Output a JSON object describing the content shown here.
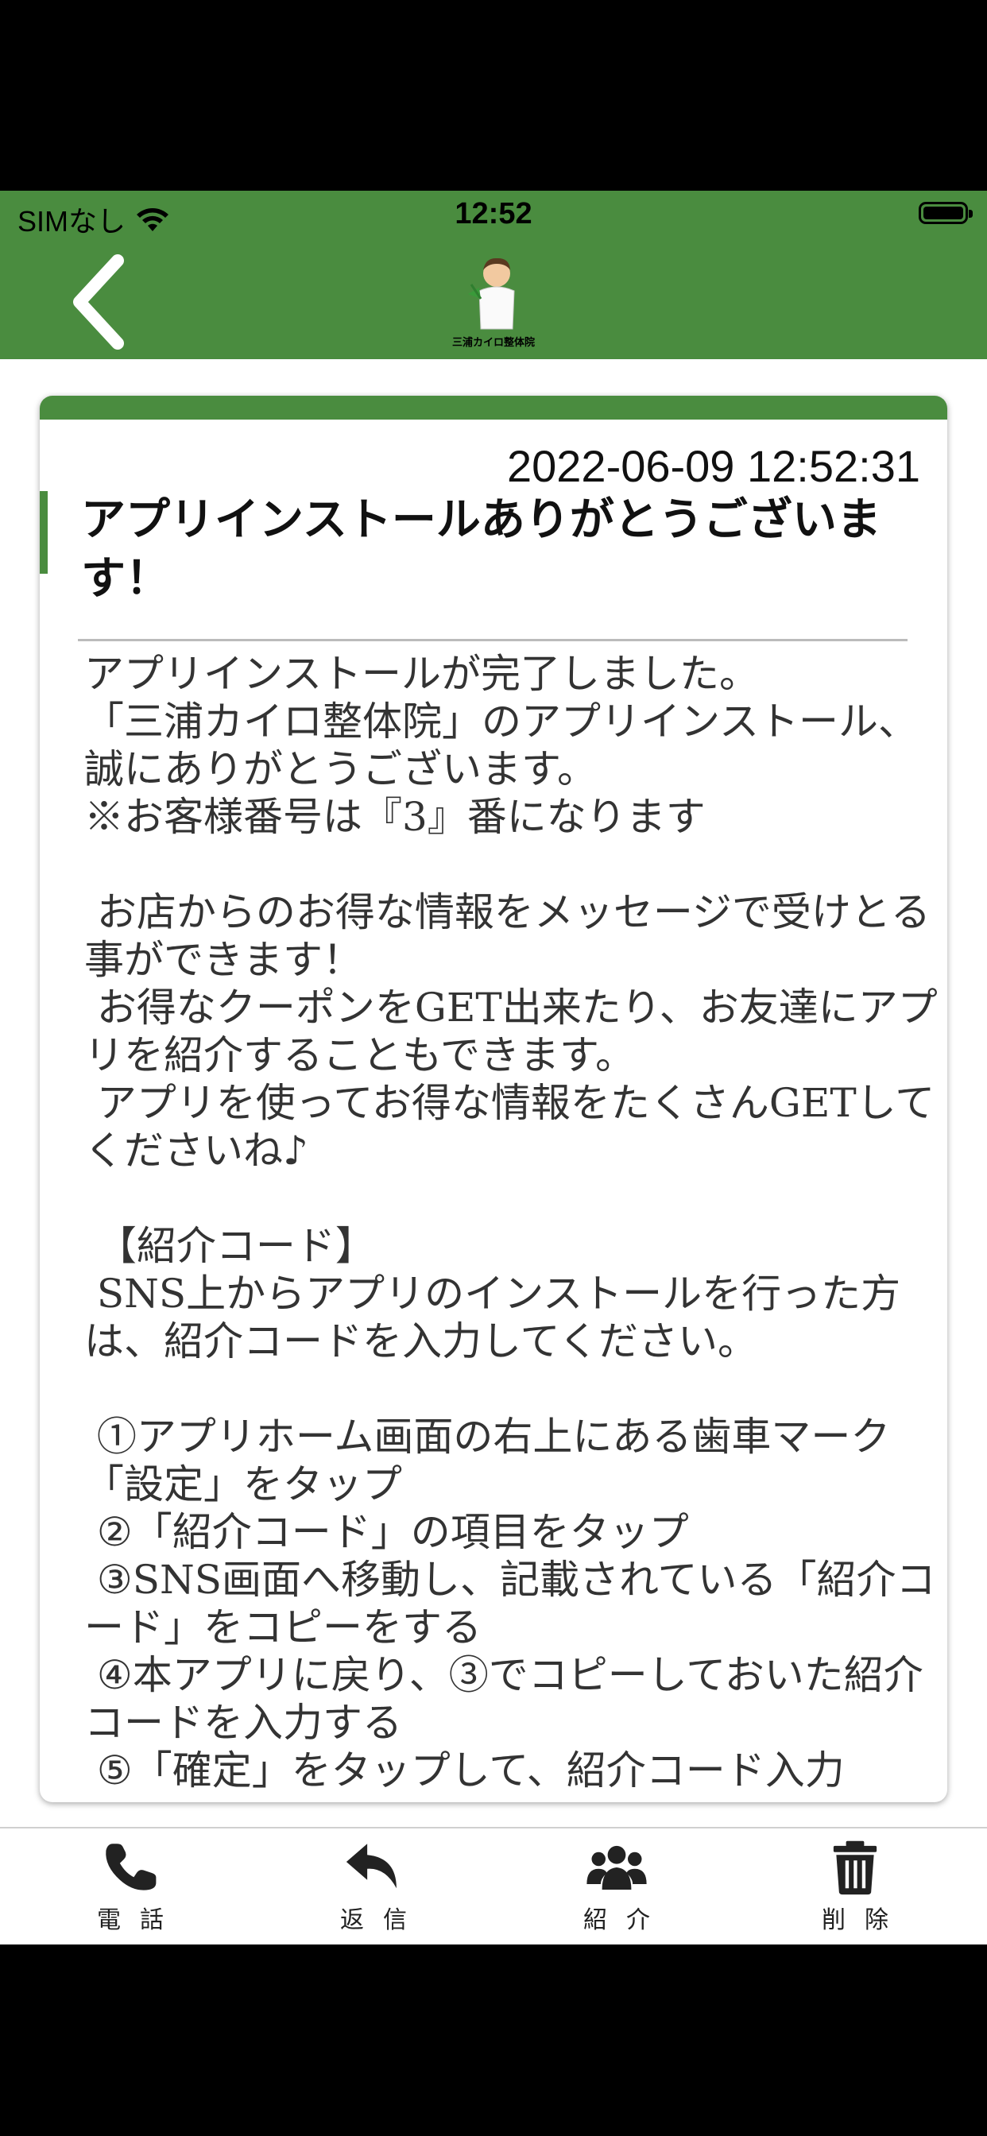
{
  "status_bar": {
    "carrier": "SIMなし",
    "time": "12:52"
  },
  "nav": {
    "logo_caption": "三浦カイロ整体院"
  },
  "message": {
    "date": "2022-06-09 12:52:31",
    "title": "アプリインストールありがとうございます！",
    "body": "アプリインストールが完了しました。\n「三浦カイロ整体院」のアプリインストール、誠にありがとうございます。\n※お客様番号は『3』番になります\n\n お店からのお得な情報をメッセージで受けとる事ができます！\n お得なクーポンをGET出来たり、お友達にアプリを紹介することもできます。\n アプリを使ってお得な情報をたくさんGETしてくださいね♪\n\n 【紹介コード】\n SNS上からアプリのインストールを行った方は、紹介コードを入力してください。\n\n ①アプリホーム画面の右上にある歯車マーク「設定」をタップ\n ②「紹介コード」の項目をタップ\n ③SNS画面へ移動し、記載されている「紹介コード」をコピーをする\n ④本アプリに戻り、③でコピーしておいた紹介コードを入力する\n ⑤「確定」をタップして、紹介コード入力"
  },
  "tabs": [
    {
      "label": "電話",
      "icon": "phone-icon"
    },
    {
      "label": "返信",
      "icon": "reply-icon"
    },
    {
      "label": "紹介",
      "icon": "users-icon"
    },
    {
      "label": "削除",
      "icon": "trash-icon"
    }
  ],
  "colors": {
    "accent": "#4a8c3f"
  }
}
